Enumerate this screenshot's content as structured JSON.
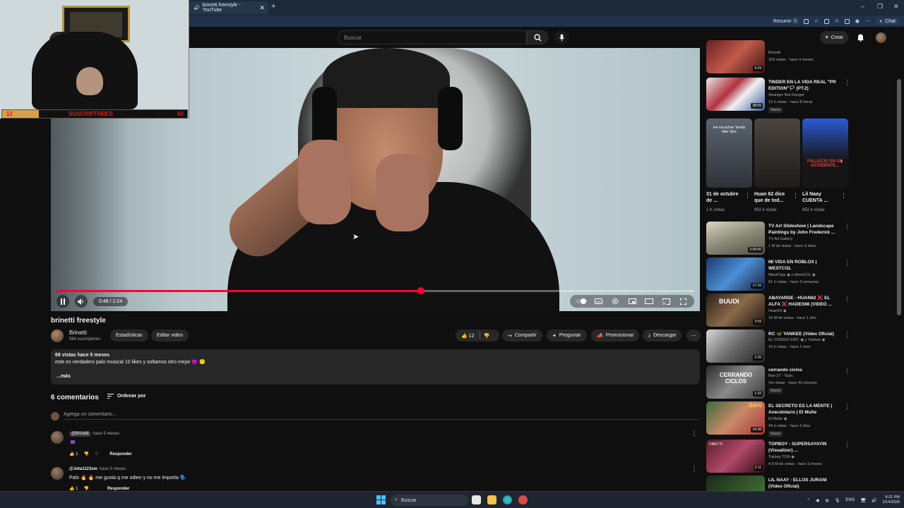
{
  "browser": {
    "tab_title": "brinetti freestyle - YouTube",
    "new_tab": "+",
    "close_tab": "✕",
    "resumir_label": "Resumir",
    "chat_label": "Chat",
    "win_min": "–",
    "win_max": "❐",
    "win_close": "✕"
  },
  "yt": {
    "search_placeholder": "Buscar",
    "create_label": "Crear"
  },
  "overlay": {
    "current_subs": "12",
    "label": "SUSCRIPTORES",
    "goal": "60"
  },
  "player": {
    "time": "0:48 / 1:24",
    "progress_fraction": 0.571
  },
  "video": {
    "title": "brinetti freestyle",
    "channel": "Brinetti",
    "subscribers": "564 suscriptores",
    "stats_btn": "Estadísticas",
    "edit_btn": "Editar video",
    "likes": "12",
    "share": "Compartir",
    "ask": "Preguntar",
    "promote": "Promocionar",
    "download": "Descargar",
    "desc_meta": "68 vistas  hace 5 meses",
    "desc_text": "este es verdadero palo musical 10 likes y soltamos otro mejor 😈 😶",
    "desc_more": "...más"
  },
  "comments": {
    "header": "6 comentarios",
    "sort_label": "Ordenar por",
    "add_placeholder": "Agrega un comentario...",
    "items": [
      {
        "author": "@Brinetti",
        "when": "hace 5 meses",
        "text": "",
        "likes": "1",
        "reply": "Responder"
      },
      {
        "author": "@Jota1123sm",
        "when": "hace 5 meses",
        "text": "Palo 🔥 🔥 me gusta q me odien y no me importa 🗣️",
        "likes": "1",
        "reply": "Responder"
      }
    ]
  },
  "sidebar": {
    "items": [
      {
        "title": "",
        "channel": "Brinetti",
        "meta": "169 vistas · hace 4 meses",
        "duration": "9:29",
        "badge": ""
      },
      {
        "title": "TINDER EN LA VIDA REAL \"PR EDITION\"🏳 (PT.2)",
        "channel": "Stranger Not Danger",
        "meta": "12 k vistas · hace 8 horas",
        "duration": "38:05",
        "badge": "Nuevo"
      },
      {
        "title": "TV Art Slideshow | Landscape Paintings by John Frederick ...",
        "channel": "TV Art Gallery",
        "meta": "1 M de vistas · hace 3 años",
        "duration": "2:00:00",
        "badge": ""
      },
      {
        "title": "MI VIDA EN ROBLOX | WESTCOL",
        "channel": "WestClips ◉ y WestCOL ◉",
        "meta": "81 k vistas · hace 3 semanas",
        "duration": "17:16",
        "badge": ""
      },
      {
        "title": "ABAYARDE - HUAN62 ❌ EL ALFA ❌ HADES66 (VIDEO ...",
        "channel": "Huan62 ◉",
        "meta": "15 M de vistas · hace 1 año",
        "duration": "3:59",
        "badge": ""
      },
      {
        "title": "RC 🦋 YANKEE (Video Oficial)",
        "channel": "EL CODIGO ENT. ◉ y Yankee ◉",
        "meta": "15 k vistas · hace 1 mes",
        "duration": "2:26",
        "badge": ""
      },
      {
        "title": "cerrando ciclos",
        "channel": "flow 27 - Topic",
        "meta": "Sin vistas · hace 43 minutos",
        "duration": "1:32",
        "badge": "Nuevo"
      },
      {
        "title": "EL SECRETO ES LA MENTE | Anecdotario | El Muñe",
        "channel": "El Muñe ◉",
        "meta": "34 k vistas · hace 3 días",
        "duration": "24:38",
        "badge": "Nuevo"
      },
      {
        "title": "TOPBOY - SUPERSAYAYIN (Visualizer) ...",
        "channel": "Topboy TGR ◉",
        "meta": "4.6 M de vistas · hace 3 meses",
        "duration": "2:11",
        "badge": ""
      },
      {
        "title": "LIL NAAY - ELLOS JURANI (Video Oficial)",
        "channel": "",
        "meta": "",
        "duration": "",
        "badge": ""
      }
    ],
    "shorts": [
      {
        "title": "31 de octubre de ...",
        "views": "1 K vistas"
      },
      {
        "title": "Huan 62 dice que de tod...",
        "views": "902 k vistas"
      },
      {
        "title": "Lil Naay CUENTA ...",
        "views": "852 k vistas"
      }
    ],
    "short_captions": [
      "me escuchan 'bootty bike' dice",
      "FALLECIO EN UN ACCIDENTE..."
    ],
    "thumb_texts": [
      "CERRANDO CICLOS",
      "ÉXITO",
      "DIBETTI",
      "BUUDI"
    ]
  },
  "taskbar": {
    "search_label": "Buscar",
    "lang": "ENG",
    "time": "8:21 PM",
    "date": "2/14/2026"
  }
}
